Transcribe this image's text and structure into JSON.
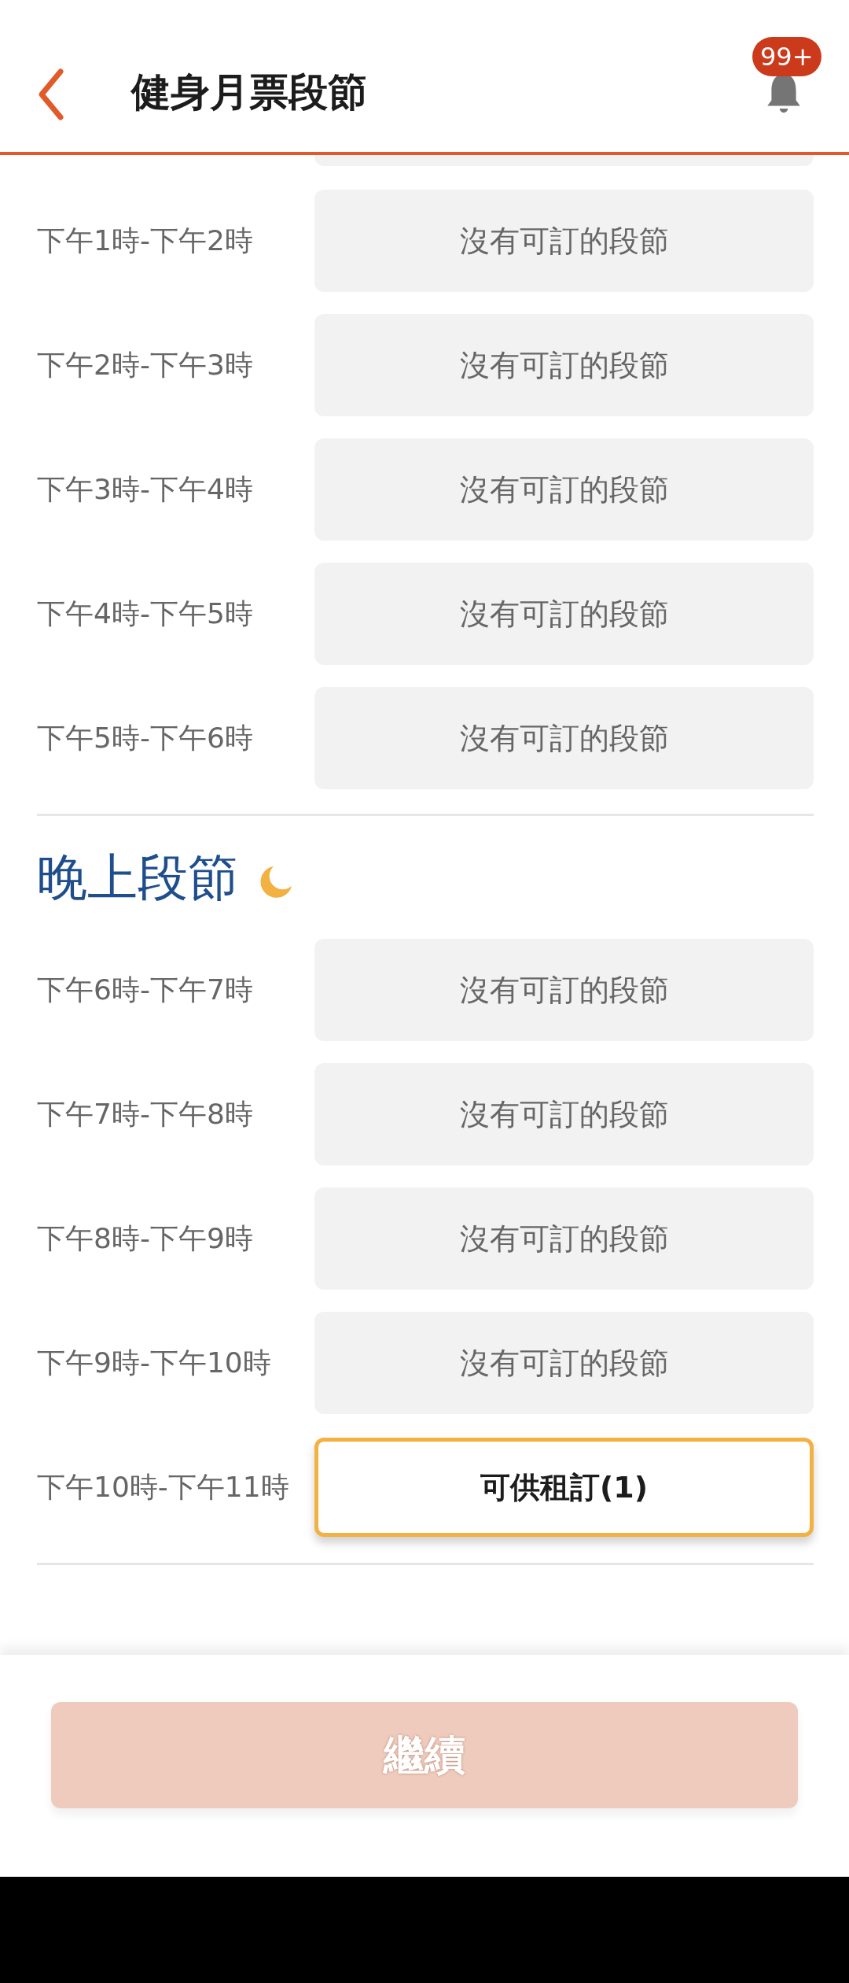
{
  "header": {
    "title": "健身月票段節",
    "notification_badge": "99+"
  },
  "sections": [
    {
      "rows": [
        {
          "time": "下午1時-下午2時",
          "status": "沒有可訂的段節",
          "available": false
        },
        {
          "time": "下午2時-下午3時",
          "status": "沒有可訂的段節",
          "available": false
        },
        {
          "time": "下午3時-下午4時",
          "status": "沒有可訂的段節",
          "available": false
        },
        {
          "time": "下午4時-下午5時",
          "status": "沒有可訂的段節",
          "available": false
        },
        {
          "time": "下午5時-下午6時",
          "status": "沒有可訂的段節",
          "available": false
        }
      ]
    },
    {
      "title": "晚上段節",
      "rows": [
        {
          "time": "下午6時-下午7時",
          "status": "沒有可訂的段節",
          "available": false
        },
        {
          "time": "下午7時-下午8時",
          "status": "沒有可訂的段節",
          "available": false
        },
        {
          "time": "下午8時-下午9時",
          "status": "沒有可訂的段節",
          "available": false
        },
        {
          "time": "下午9時-下午10時",
          "status": "沒有可訂的段節",
          "available": false
        },
        {
          "time": "下午10時-下午11時",
          "status": "可供租訂(1)",
          "available": true
        }
      ]
    }
  ],
  "continue_button": {
    "label": "繼續",
    "disabled": true
  }
}
